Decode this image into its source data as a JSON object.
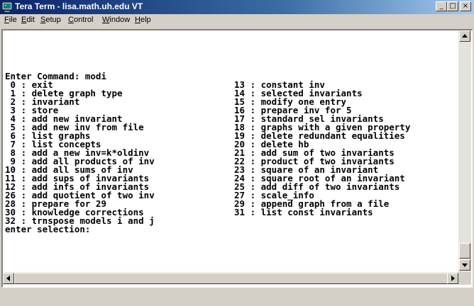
{
  "window": {
    "title": "Tera Term - lisa.math.uh.edu VT",
    "minimize": "_",
    "maximize": "□",
    "close": "×"
  },
  "menu": {
    "file": "File",
    "edit": "Edit",
    "setup": "Setup",
    "control": "Control",
    "window": "Window",
    "help": "Help"
  },
  "terminal": {
    "prompt": "Enter Command: modi",
    "options_left": [
      " 0 : exit",
      " 1 : delete graph type",
      " 2 : invariant",
      " 3 : store",
      " 4 : add new invariant",
      " 5 : add new inv from file",
      " 6 : list graphs",
      " 7 : list concepts",
      " 8 : add a new inv=k*oldinv",
      " 9 : add all products of inv",
      "10 : add all sums of inv",
      "11 : add sups of invariants",
      "12 : add infs of invariants",
      "26 : add quotient of two inv",
      "28 : prepare for 29",
      "30 : knowledge corrections",
      "32 : trnspose models i and j"
    ],
    "options_right": [
      "13 : constant inv",
      "14 : selected invariants",
      "15 : modify one entry",
      "16 : prepare inv for 5",
      "17 : standard sel invariants",
      "18 : graphs with a given property",
      "19 : delete redundant equalities",
      "20 : delete hb",
      "21 : add sum of two invariants",
      "22 : product of two invariants",
      "23 : square of an invariant",
      "24 : square root of an invariant",
      "25 : add diff of two invariants",
      "27 : scale_info",
      "29 : append graph from a file",
      "31 : list const invariants"
    ],
    "selection_prompt": "enter selection:"
  },
  "icons": {
    "app": "terminal-app-icon",
    "scroll_up": "arrow-up-icon",
    "scroll_down": "arrow-down-icon",
    "scroll_left": "arrow-left-icon",
    "scroll_right": "arrow-right-icon"
  }
}
